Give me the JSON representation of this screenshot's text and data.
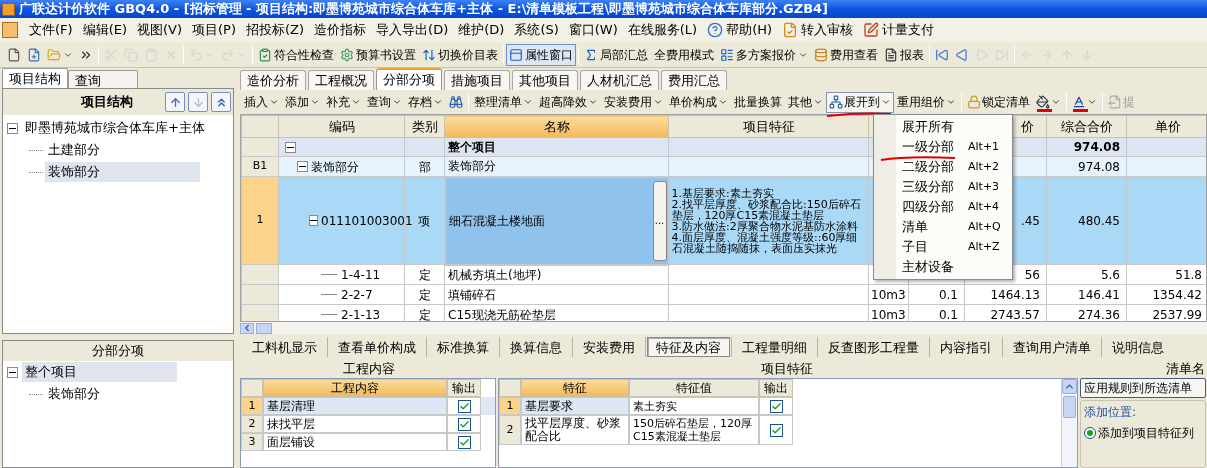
{
  "window": {
    "title": "广联达计价软件 GBQ4.0 - [招标管理 - 项目结构:即墨博苑城市综合体车库+主体 - E:\\清单模板工程\\即墨博苑城市综合体车库部分.GZB4]"
  },
  "menu_bar": [
    {
      "kind": "text",
      "label": "文件(F)"
    },
    {
      "kind": "text",
      "label": "编辑(E)"
    },
    {
      "kind": "text",
      "label": "视图(V)"
    },
    {
      "kind": "text",
      "label": "项目(P)"
    },
    {
      "kind": "text",
      "label": "招投标(Z)"
    },
    {
      "kind": "text",
      "label": "造价指标"
    },
    {
      "kind": "text",
      "label": "导入导出(D)"
    },
    {
      "kind": "text",
      "label": "维护(D)"
    },
    {
      "kind": "text",
      "label": "系统(S)"
    },
    {
      "kind": "text",
      "label": "窗口(W)"
    },
    {
      "kind": "text",
      "label": "在线服务(L)"
    },
    {
      "kind": "help",
      "label": "帮助(H)"
    },
    {
      "kind": "audit",
      "label": "转入审核"
    },
    {
      "kind": "pay",
      "label": "计量支付"
    }
  ],
  "toolbar": [
    {
      "kind": "new",
      "disabled": false
    },
    {
      "kind": "new-project",
      "disabled": false
    },
    {
      "kind": "open",
      "disabled": false,
      "dropdown": true
    },
    {
      "kind": "more"
    },
    {
      "kind": "separator"
    },
    {
      "kind": "cut",
      "disabled": true
    },
    {
      "kind": "copy",
      "disabled": true
    },
    {
      "kind": "paste",
      "disabled": true
    },
    {
      "kind": "delete",
      "disabled": true
    },
    {
      "kind": "separator"
    },
    {
      "kind": "undo",
      "disabled": true,
      "dropdown": true
    },
    {
      "kind": "redo",
      "disabled": true,
      "dropdown": true
    },
    {
      "kind": "separator"
    },
    {
      "kind": "check",
      "label": "符合性检查",
      "disabled": false,
      "pressed": false
    },
    {
      "kind": "settings",
      "label": "预算书设置",
      "disabled": false,
      "pressed": false
    },
    {
      "kind": "switch",
      "label": "切换价目表",
      "disabled": false,
      "pressed": false
    },
    {
      "kind": "separator"
    },
    {
      "kind": "window",
      "label": "属性窗口",
      "disabled": false,
      "pressed": true
    },
    {
      "kind": "separator"
    },
    {
      "kind": "sum",
      "label": "局部汇总",
      "disabled": false,
      "pressed": false
    },
    {
      "kind": "text",
      "label": "全费用模式",
      "disabled": false,
      "pressed": false
    },
    {
      "kind": "list",
      "label": "多方案报价",
      "disabled": false,
      "pressed": false,
      "dropdown": true
    },
    {
      "kind": "cost",
      "label": "费用查看",
      "disabled": false,
      "pressed": false
    },
    {
      "kind": "report",
      "label": "报表",
      "disabled": false,
      "pressed": false
    },
    {
      "kind": "separator"
    },
    {
      "kind": "first",
      "disabled": false
    },
    {
      "kind": "prev",
      "disabled": false
    },
    {
      "kind": "next",
      "disabled": true
    },
    {
      "kind": "last",
      "disabled": true
    },
    {
      "kind": "separator"
    },
    {
      "kind": "left",
      "disabled": true
    },
    {
      "kind": "right",
      "disabled": true
    },
    {
      "kind": "up",
      "disabled": true
    },
    {
      "kind": "down",
      "disabled": true
    }
  ],
  "left_panel": {
    "tabs": [
      {
        "label": "项目结构",
        "selected": true
      },
      {
        "label": "查询",
        "selected": false
      }
    ],
    "title": "项目结构",
    "buttons": [
      {
        "kind": "up",
        "disabled": false
      },
      {
        "kind": "down",
        "disabled": true
      },
      {
        "kind": "collapse",
        "disabled": false
      }
    ],
    "tree": [
      {
        "label": "即墨博苑城市综合体车库+主体",
        "expanded": true,
        "selected": false,
        "children": [
          {
            "label": "土建部分",
            "selected": false
          },
          {
            "label": "装饰部分",
            "selected": true
          }
        ]
      }
    ],
    "lower_title": "分部分项",
    "lower_tree": [
      {
        "label": "整个项目",
        "expanded": true,
        "selected": true,
        "children": [
          {
            "label": "装饰部分",
            "selected": false
          }
        ]
      }
    ]
  },
  "tabs": [
    {
      "label": "造价分析",
      "selected": false
    },
    {
      "label": "工程概况",
      "selected": false
    },
    {
      "label": "分部分项",
      "selected": true
    },
    {
      "label": "措施项目",
      "selected": false
    },
    {
      "label": "其他项目",
      "selected": false
    },
    {
      "label": "人材机汇总",
      "selected": false
    },
    {
      "label": "费用汇总",
      "selected": false
    }
  ],
  "toolbar2": [
    {
      "kind": "text",
      "label": "插入",
      "dropdown": true,
      "pressed": false,
      "marked": false
    },
    {
      "kind": "text",
      "label": "添加",
      "dropdown": true,
      "pressed": false,
      "marked": false
    },
    {
      "kind": "text",
      "label": "补充",
      "dropdown": true,
      "pressed": false,
      "marked": false
    },
    {
      "kind": "text",
      "label": "查询",
      "dropdown": true,
      "pressed": false,
      "marked": false
    },
    {
      "kind": "text",
      "label": "存档",
      "dropdown": true,
      "pressed": false,
      "marked": false
    },
    {
      "kind": "find",
      "dropdown": false,
      "pressed": false,
      "marked": false
    },
    {
      "kind": "separator"
    },
    {
      "kind": "text",
      "label": "整理清单",
      "dropdown": true,
      "pressed": false,
      "marked": false
    },
    {
      "kind": "text",
      "label": "超高降效",
      "dropdown": true,
      "pressed": false,
      "marked": false
    },
    {
      "kind": "text",
      "label": "安装费用",
      "dropdown": true,
      "pressed": false,
      "marked": false
    },
    {
      "kind": "text",
      "label": "单价构成",
      "dropdown": true,
      "pressed": false,
      "marked": false
    },
    {
      "kind": "text",
      "label": "批量换算",
      "dropdown": false,
      "pressed": false,
      "marked": false
    },
    {
      "kind": "text",
      "label": "其他",
      "dropdown": true,
      "pressed": false,
      "marked": false
    },
    {
      "kind": "expand",
      "label": "展开到",
      "dropdown": true,
      "pressed": true,
      "marked": true
    },
    {
      "kind": "text",
      "label": "重用组价",
      "dropdown": true,
      "pressed": false,
      "marked": false
    },
    {
      "kind": "separator"
    },
    {
      "kind": "lock",
      "label": "锁定清单",
      "dropdown": false,
      "pressed": false,
      "marked": false
    },
    {
      "kind": "fill",
      "dropdown": true,
      "pressed": false,
      "marked": false
    },
    {
      "kind": "separator"
    },
    {
      "kind": "font",
      "dropdown": true,
      "pressed": false,
      "marked": false
    },
    {
      "kind": "separator"
    },
    {
      "kind": "extract",
      "label": "提",
      "dropdown": false,
      "pressed": false,
      "marked": false,
      "disabled": true
    }
  ],
  "grid": {
    "columns": [
      {
        "selected": false
      },
      {
        "label": "编码",
        "selected": false
      },
      {
        "label": "类别",
        "selected": false
      },
      {
        "label": "名称",
        "selected": true
      },
      {
        "label": "项目特征",
        "selected": false
      },
      {},
      {},
      {
        "label": "价",
        "selected": false
      },
      {
        "label": "综合合价",
        "selected": false
      },
      {
        "label": "单价",
        "selected": false
      }
    ],
    "rows": [
      {
        "kind": "root",
        "name": "整个项目",
        "total": "974.08",
        "expanded": true,
        "selected": false,
        "children": [
          {
            "kind": "division",
            "num": "B1",
            "code": "装饰部分",
            "type": "部",
            "name": "装饰部分",
            "total": "974.08",
            "expanded": true,
            "selected": false,
            "children": [
              {
                "kind": "item",
                "num": "1",
                "code": "011101003001",
                "type": "项",
                "name": "细石混凝土楼地面",
                "name_button": "...",
                "feature": [
                  "1.基层要求:素土夯实",
                  "2.找平层厚度、砂浆配合比:150后碎石垫层，120厚C15素混凝土垫层",
                  "3.防水做法:2厚聚合物水泥基防水涂料",
                  "4.面层厚度、混凝土强度等级::60厚细石混凝土随捣随抹，表面压实抹光"
                ],
                "col_8": ".45",
                "total": "480.45",
                "expanded": true,
                "selected": true,
                "children": [
                  {
                    "kind": "quota",
                    "code": "1-4-11",
                    "type": "定",
                    "name": "机械夯填土(地坪)",
                    "col_8": "56",
                    "total": "5.6",
                    "unit_price": "51.8",
                    "selected": false
                  },
                  {
                    "kind": "quota",
                    "code": "2-2-7",
                    "type": "定",
                    "name": "填铺碎石",
                    "unit": "10m3",
                    "quantity": "0.1",
                    "col_8": "1464.13",
                    "total": "146.41",
                    "unit_price": "1354.42",
                    "selected": false
                  },
                  {
                    "kind": "quota",
                    "code": "2-1-13",
                    "type": "定",
                    "name": "C15现浇无筋砼垫层",
                    "unit": "10m3",
                    "quantity": "0.1",
                    "col_8": "2743.57",
                    "total": "274.36",
                    "unit_price": "2537.99",
                    "selected": false
                  }
                ]
              }
            ]
          }
        ]
      }
    ]
  },
  "expand_menu": [
    {
      "label": "展开所有",
      "marked": false
    },
    {
      "label": "一级分部",
      "shortcut": "Alt+1",
      "marked": true
    },
    {
      "label": "二级分部",
      "shortcut": "Alt+2",
      "marked": false
    },
    {
      "label": "三级分部",
      "shortcut": "Alt+3",
      "marked": false
    },
    {
      "label": "四级分部",
      "shortcut": "Alt+4",
      "marked": false
    },
    {
      "label": "清单",
      "shortcut": "Alt+Q",
      "marked": false
    },
    {
      "label": "子目",
      "shortcut": "Alt+Z",
      "marked": false
    },
    {
      "label": "主材设备",
      "marked": false
    }
  ],
  "bottom_tabs": [
    {
      "label": "工料机显示",
      "selected": false
    },
    {
      "label": "查看单价构成",
      "selected": false
    },
    {
      "label": "标准换算",
      "selected": false
    },
    {
      "label": "换算信息",
      "selected": false
    },
    {
      "label": "安装费用",
      "selected": false
    },
    {
      "label": "特征及内容",
      "selected": true
    },
    {
      "label": "工程量明细",
      "selected": false
    },
    {
      "label": "反查图形工程量",
      "selected": false
    },
    {
      "label": "内容指引",
      "selected": false
    },
    {
      "label": "查询用户清单",
      "selected": false
    },
    {
      "label": "说明信息",
      "selected": false
    }
  ],
  "content_table": {
    "title": "工程内容",
    "columns": [
      {
        "label": "工程内容",
        "selected": true
      },
      {
        "label": "输出",
        "selected": false
      }
    ],
    "rows": [
      {
        "num": "1",
        "text": "基层清理",
        "output": true,
        "selected": true
      },
      {
        "num": "2",
        "text": "抹找平层",
        "output": true,
        "selected": false
      },
      {
        "num": "3",
        "text": "面层铺设",
        "output": true,
        "selected": false
      }
    ]
  },
  "feature_table": {
    "title": "项目特征",
    "columns": [
      {
        "label": "特征",
        "selected": true
      },
      {
        "label": "特征值",
        "selected": false
      },
      {
        "label": "输出",
        "selected": false
      }
    ],
    "rows": [
      {
        "num": "1",
        "feature": "基层要求",
        "value": "素土夯实",
        "output": true,
        "selected": true
      },
      {
        "num": "2",
        "feature": "找平层厚度、砂浆配合比",
        "value": "150后碎石垫层，120厚C15素混凝土垫层",
        "output": true,
        "selected": false
      }
    ]
  },
  "rules": {
    "title": "清单名",
    "button": "应用规则到所选清单",
    "group": "添加位置:",
    "options": [
      {
        "label": "添加到项目特征列",
        "selected": true
      }
    ]
  }
}
